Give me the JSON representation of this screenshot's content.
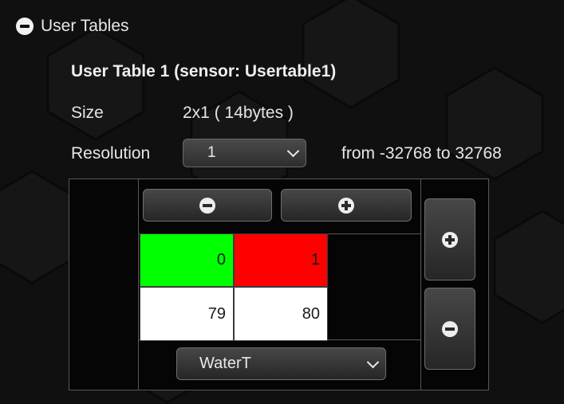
{
  "section": {
    "title": "User Tables",
    "icon": "minus-circle-icon"
  },
  "table": {
    "title": "User Table 1  (sensor: Usertable1)",
    "size_label": "Size",
    "size_value": "2x1 ( 14bytes )",
    "resolution_label": "Resolution",
    "resolution_value": "1",
    "range_text": "from -32768 to 32768"
  },
  "grid": {
    "header_cells": [
      {
        "value": "0",
        "color": "#00ff00"
      },
      {
        "value": "1",
        "color": "#ff0000"
      }
    ],
    "data_cells": [
      {
        "value": "79",
        "color": "#ffffff"
      },
      {
        "value": "80",
        "color": "#ffffff"
      }
    ],
    "sensor_select_value": "WaterT",
    "buttons": {
      "remove_column": "minus-circle-icon",
      "add_column": "plus-circle-icon",
      "add_row": "plus-circle-icon",
      "remove_row": "minus-circle-icon"
    }
  }
}
